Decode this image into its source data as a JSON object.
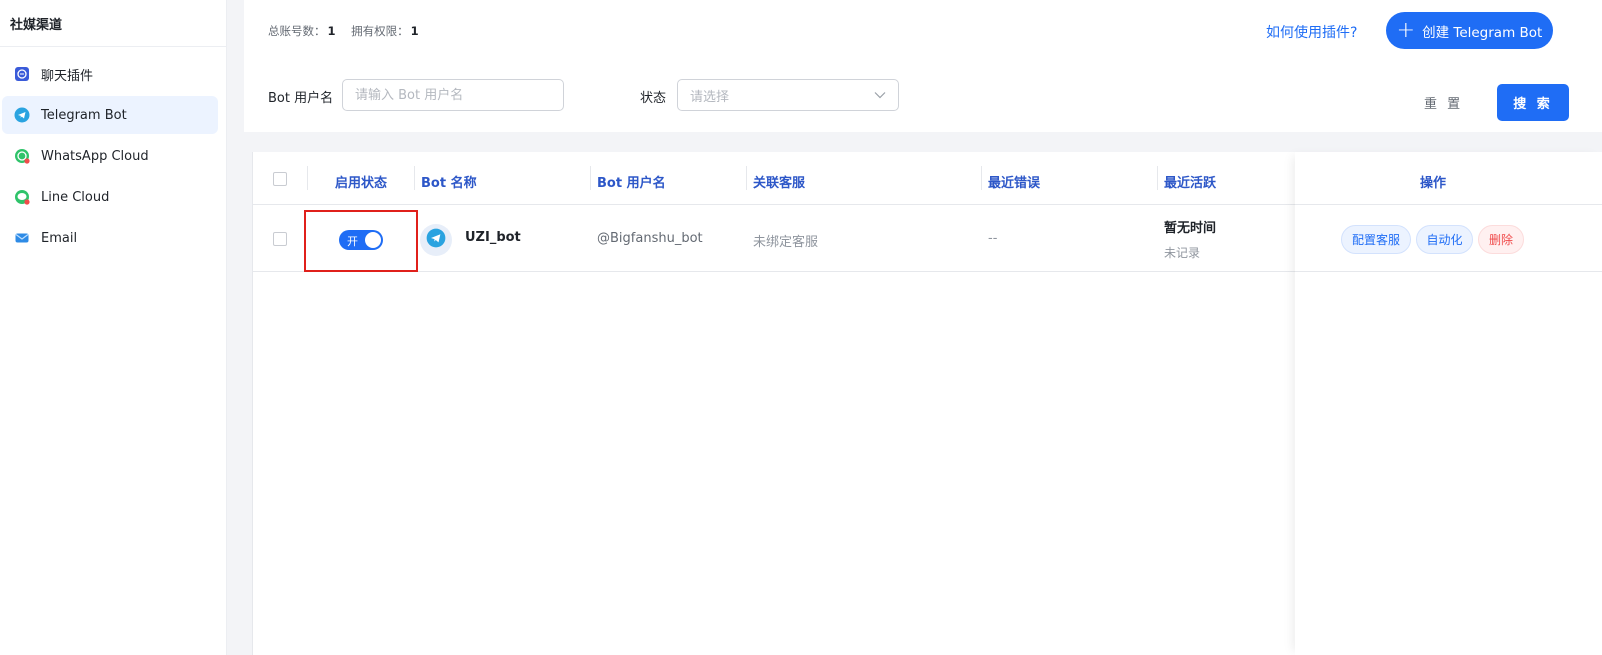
{
  "sidebar": {
    "title": "社媒渠道",
    "items": [
      {
        "label": "聊天插件",
        "icon": "chat-plugin-icon"
      },
      {
        "label": "Telegram Bot",
        "icon": "telegram-icon"
      },
      {
        "label": "WhatsApp Cloud",
        "icon": "whatsapp-icon"
      },
      {
        "label": "Line Cloud",
        "icon": "line-icon"
      },
      {
        "label": "Email",
        "icon": "email-icon"
      }
    ],
    "active_index": 1
  },
  "header": {
    "total_label": "总账号数：",
    "total_value": "1",
    "perm_label": "拥有权限：",
    "perm_value": "1",
    "help_link": "如何使用插件?",
    "create_button": "创建 Telegram Bot"
  },
  "filters": {
    "username_label": "Bot 用户名",
    "username_placeholder": "请输入 Bot 用户名",
    "status_label": "状态",
    "status_placeholder": "请选择",
    "reset_button": "重 置",
    "search_button": "搜 索"
  },
  "table": {
    "columns": [
      "启用状态",
      "Bot 名称",
      "Bot 用户名",
      "关联客服",
      "最近错误",
      "最近活跃",
      "操作"
    ],
    "rows": [
      {
        "enabled": true,
        "toggle_label": "开",
        "bot_name": "UZI_bot",
        "bot_username": "@Bigfanshu_bot",
        "linked_agent": "未绑定客服",
        "last_error": "--",
        "last_active": "暂无时间",
        "last_active_sub": "未记录",
        "actions": [
          "配置客服",
          "自动化",
          "删除"
        ]
      }
    ]
  },
  "colors": {
    "accent": "#1f6df5",
    "danger": "#f04b4b",
    "highlight": "#e0201b"
  }
}
